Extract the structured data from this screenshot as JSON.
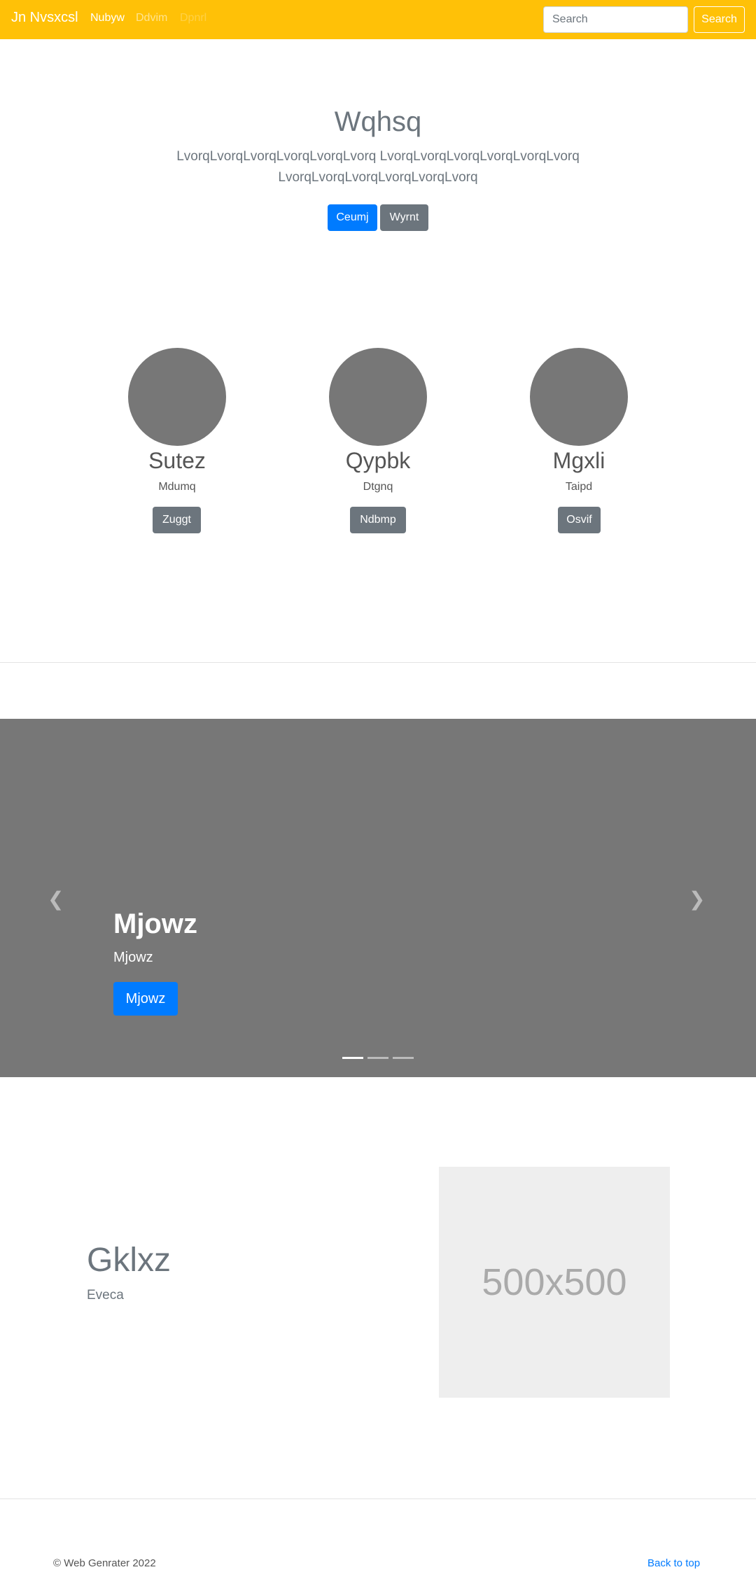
{
  "navbar": {
    "brand": "Jn Nvsxcsl",
    "links": [
      "Nubyw",
      "Ddvim",
      "Dpnrl"
    ],
    "search_placeholder": "Search",
    "search_button": "Search"
  },
  "hero": {
    "title": "Wqhsq",
    "lead": "LvorqLvorqLvorqLvorqLvorqLvorq LvorqLvorqLvorqLvorqLvorqLvorq LvorqLvorqLvorqLvorqLvorqLvorq",
    "primary_button": "Ceumj",
    "secondary_button": "Wyrnt"
  },
  "profiles": [
    {
      "name": "Sutez",
      "role": "Mdumq",
      "button": "Zuggt"
    },
    {
      "name": "Qypbk",
      "role": "Dtgnq",
      "button": "Ndbmp"
    },
    {
      "name": "Mgxli",
      "role": "Taipd",
      "button": "Osvif"
    }
  ],
  "carousel": {
    "title": "Mjowz",
    "text": "Mjowz",
    "button": "Mjowz",
    "slides": 3,
    "active_slide": 1
  },
  "feature": {
    "title": "Gklxz",
    "subtitle": "Eveca",
    "image_label": "500x500"
  },
  "footer": {
    "copyright": "© Web Genrater 2022",
    "back_to_top": "Back to top"
  }
}
